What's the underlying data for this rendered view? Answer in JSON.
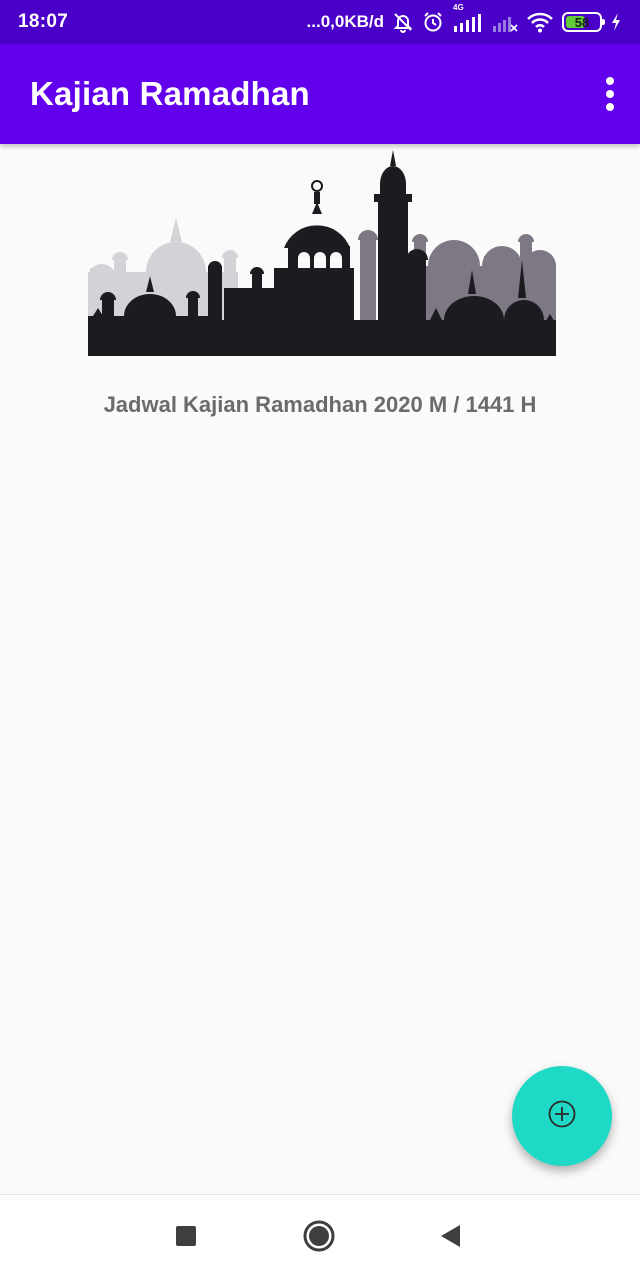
{
  "status_bar": {
    "time": "18:07",
    "network_speed": "...0,0KB/d",
    "network_type": "4G",
    "battery_level": "58",
    "battery_percent": 58,
    "icons": [
      "mute-icon",
      "alarm-icon",
      "signal-icon",
      "signal-empty-icon",
      "wifi-icon",
      "battery-icon",
      "charging-icon"
    ]
  },
  "app_bar": {
    "title": "Kajian Ramadhan",
    "menu_icon": "overflow-menu-icon"
  },
  "main": {
    "banner_icon": "mosque-silhouette-banner",
    "subtitle": "Jadwal Kajian Ramadhan 2020 M / 1441 H"
  },
  "fab": {
    "icon": "add-circle-icon"
  },
  "navigation": {
    "recents_icon": "square-icon",
    "home_icon": "circle-icon",
    "back_icon": "triangle-back-icon"
  },
  "colors": {
    "status_bar": "#4a00c9",
    "app_bar": "#6200ee",
    "fab": "#1ed9c6",
    "subtitle": "#6b6b6b",
    "background": "#fafafa"
  }
}
